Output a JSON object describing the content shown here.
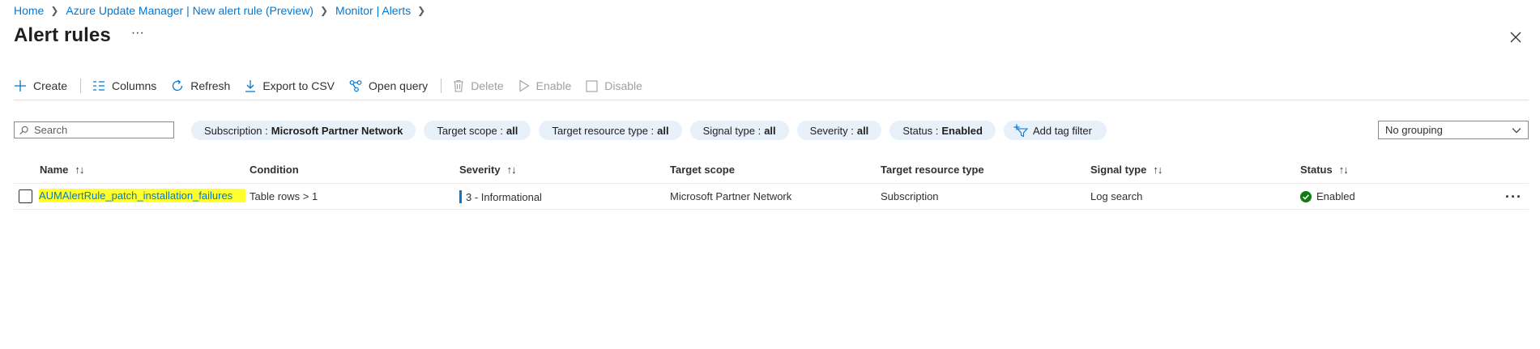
{
  "breadcrumb": [
    {
      "label": "Home"
    },
    {
      "label": "Azure Update Manager | New alert rule (Preview)"
    },
    {
      "label": "Monitor | Alerts"
    }
  ],
  "page": {
    "title": "Alert rules",
    "more": "···"
  },
  "toolbar": {
    "create": "Create",
    "columns": "Columns",
    "refresh": "Refresh",
    "export": "Export to CSV",
    "open_query": "Open query",
    "delete": "Delete",
    "enable": "Enable",
    "disable": "Disable"
  },
  "search": {
    "placeholder": "Search",
    "value": ""
  },
  "filters": {
    "subscription": {
      "label": "Subscription :",
      "value": "Microsoft Partner Network"
    },
    "target_scope": {
      "label": "Target scope :",
      "value": "all"
    },
    "target_resource_type": {
      "label": "Target resource type :",
      "value": "all"
    },
    "signal_type": {
      "label": "Signal type :",
      "value": "all"
    },
    "severity": {
      "label": "Severity :",
      "value": "all"
    },
    "status": {
      "label": "Status :",
      "value": "Enabled"
    },
    "add_tag": "Add tag filter"
  },
  "grouping": {
    "selected": "No grouping"
  },
  "table": {
    "columns": {
      "name": "Name",
      "condition": "Condition",
      "severity": "Severity",
      "target_scope": "Target scope",
      "target_resource_type": "Target resource type",
      "signal_type": "Signal type",
      "status": "Status"
    },
    "sort_glyph": "↑↓",
    "rows": [
      {
        "name": "AUMAlertRule_patch_installation_failures",
        "condition": "Table rows > 1",
        "severity": "3 - Informational",
        "target_scope": "Microsoft Partner Network",
        "target_resource_type": "Subscription",
        "signal_type": "Log search",
        "status": "Enabled",
        "more": "···"
      }
    ]
  },
  "colors": {
    "accent": "#0078d4",
    "status_ok": "#107c10",
    "highlight": "#ffff2e",
    "pill_bg": "#e8f0fa"
  }
}
